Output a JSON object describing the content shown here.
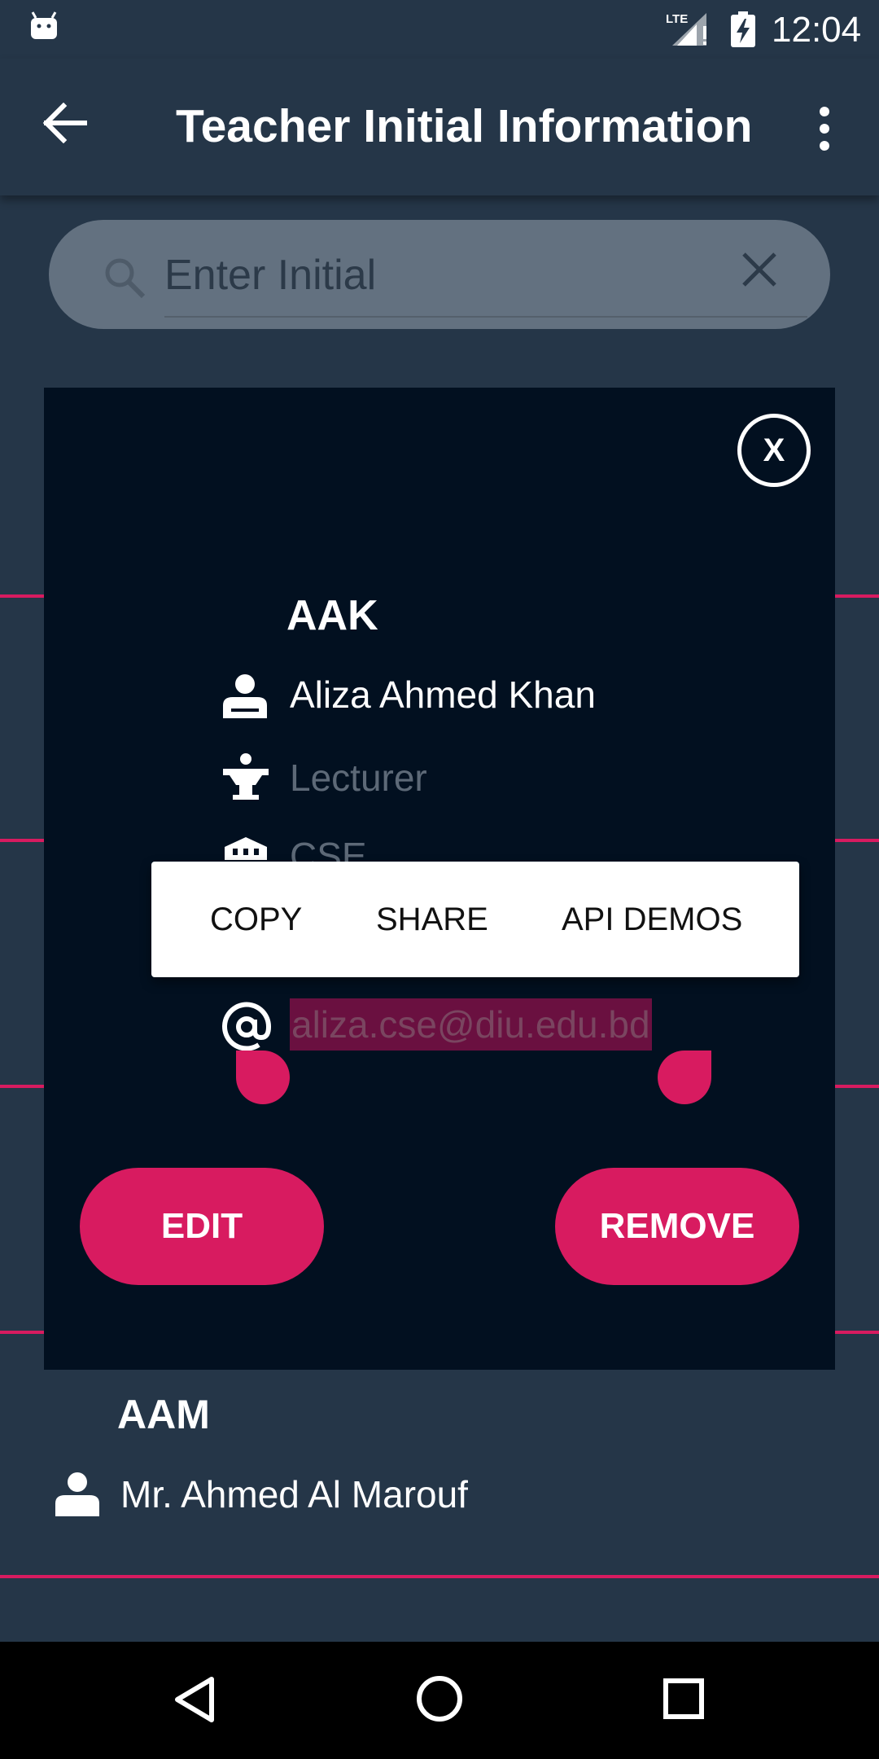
{
  "status_bar": {
    "time": "12:04",
    "network": "LTE"
  },
  "app_bar": {
    "title": "Teacher Initial Information"
  },
  "search": {
    "placeholder": "Enter Initial",
    "value": ""
  },
  "dialog": {
    "close_label": "X",
    "initial": "AAK",
    "name": "Aliza Ahmed Khan",
    "designation": "Lecturer",
    "department": "CSE",
    "email": "aliza.cse@diu.edu.bd",
    "edit_label": "EDIT",
    "remove_label": "REMOVE"
  },
  "selection_menu": {
    "items": [
      "COPY",
      "SHARE",
      "API DEMOS"
    ]
  },
  "list": {
    "items": [
      {
        "initial": "AAM",
        "name": "Mr. Ahmed Al Marouf"
      }
    ]
  },
  "colors": {
    "accent": "#d81b60",
    "background": "#253648",
    "dialog": "#021020",
    "search": "#637180"
  },
  "icons": [
    "android-icon",
    "lte-signal-icon",
    "battery-charging-icon",
    "back-arrow-icon",
    "overflow-menu-icon",
    "search-icon",
    "clear-icon",
    "person-icon",
    "designation-icon",
    "department-icon",
    "email-icon",
    "nav-back-icon",
    "nav-home-icon",
    "nav-recents-icon"
  ]
}
